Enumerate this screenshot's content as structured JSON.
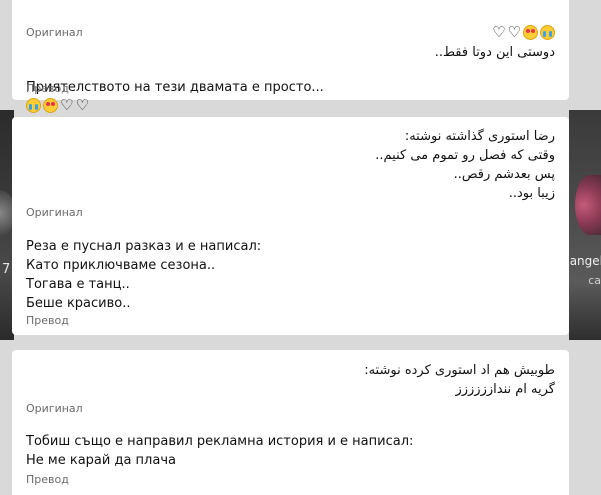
{
  "cards": [
    {
      "original_text": "دوستی این دوتا فقط..",
      "original_label": "Оригинал",
      "translation_text": "Приятелството на тези двамата е просто...",
      "translation_label": "Превод",
      "emojis": [
        "loudly-crying-face",
        "smiling-face-with-hearts",
        "white-heart",
        "white-heart"
      ]
    },
    {
      "original_text": "رضا استوری گذاشته نوشته:\nوقتی که فصل رو تموم می کنیم..\nپس بعدشم رقص..\nزیبا بود..",
      "original_label": "Оригинал",
      "translation_text": "Реза е пуснал разказ и е написал:\nКато приключваме сезона..\nТогава е танц..\nБеше красиво..",
      "translation_label": "Превод"
    },
    {
      "original_text": "طوبیش هم اد استوری کرده نوشته:\nگریه ام نندازززززز",
      "original_label": "Оригинал",
      "translation_text": "Тобиш също е направил рекламна история и е написал:\nНе ме карай да плача",
      "translation_label": "Превод"
    }
  ],
  "background": {
    "left_text": "7",
    "right_text_1": "angel",
    "right_text_2": "ca"
  },
  "icons": {
    "white_heart": "♡"
  }
}
